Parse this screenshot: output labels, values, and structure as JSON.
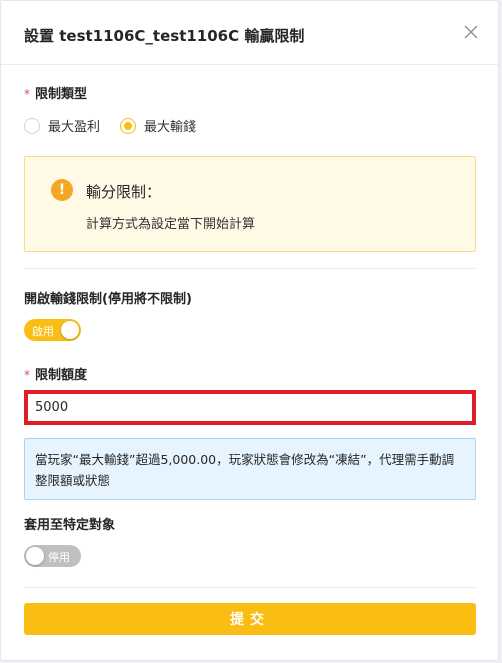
{
  "modal": {
    "title": "設置 test1106C_test1106C 輸贏限制"
  },
  "limit_type": {
    "required_mark": "*",
    "label": "限制類型",
    "options": [
      {
        "label": "最大盈利",
        "selected": false
      },
      {
        "label": "最大輸錢",
        "selected": true
      }
    ]
  },
  "warning": {
    "icon": "!",
    "title": "輸分限制：",
    "text": "計算方式為設定當下開始計算"
  },
  "loss_limit_toggle": {
    "label": "開啟輸錢限制(停用將不限制)",
    "state_label": "啟用",
    "on": true
  },
  "limit_amount": {
    "required_mark": "*",
    "label": "限制額度",
    "value": "5000"
  },
  "info": {
    "text": "當玩家“最大輸錢”超過5,000.00，玩家狀態會修改為“凍結”，代理需手動調整限額或狀態"
  },
  "apply_target_toggle": {
    "label": "套用至特定對象",
    "state_label": "停用",
    "on": false
  },
  "submit": {
    "label": "提交"
  },
  "colors": {
    "accent": "#f9bd13",
    "highlight_border": "#e11d2a",
    "info_bg": "#e6f4ff",
    "warn_bg": "#fff9e6"
  }
}
